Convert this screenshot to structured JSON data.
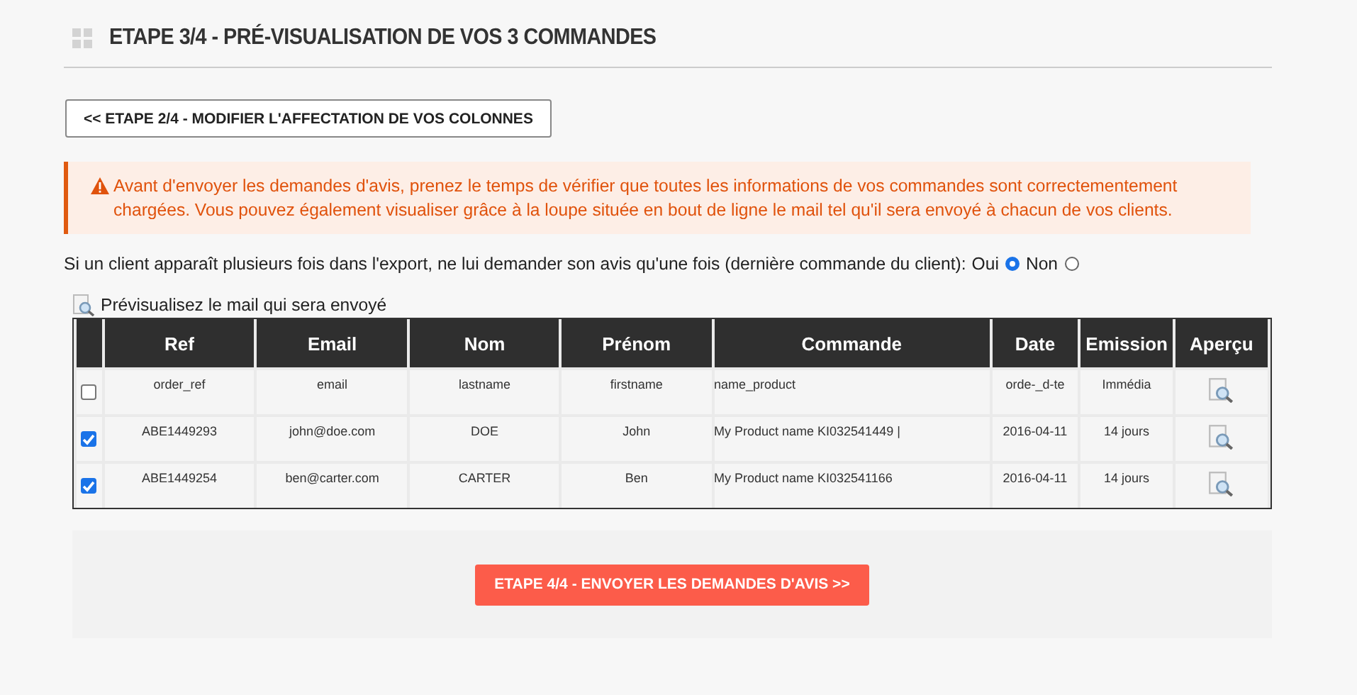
{
  "header": {
    "title": "ETAPE 3/4 - PRÉ-VISUALISATION DE VOS 3 COMMANDES"
  },
  "back_button": "<< ETAPE 2/4 - MODIFIER L'AFFECTATION DE VOS COLONNES",
  "alert": {
    "text": "Avant d'envoyer les demandes d'avis, prenez le temps de vérifier que toutes les informations de vos commandes sont correctementement chargées. Vous pouvez également visualiser grâce à la loupe située en bout de ligne le mail tel qu'il sera envoyé à chacun de vos clients."
  },
  "dedupe": {
    "question": "Si un client apparaît plusieurs fois dans l'export, ne lui demander son avis qu'une fois (dernière commande du client):",
    "options": [
      {
        "label": "Oui",
        "selected": true
      },
      {
        "label": "Non",
        "selected": false
      }
    ]
  },
  "preview_hint": "Prévisualisez le mail qui sera envoyé",
  "table": {
    "columns": [
      "Ref",
      "Email",
      "Nom",
      "Prénom",
      "Commande",
      "Date",
      "Emission",
      "Aperçu"
    ],
    "rows": [
      {
        "checked": false,
        "cells": [
          "order_ref",
          "email",
          "lastname",
          "firstname",
          "name_product",
          "orde-_d-te",
          "Immédia"
        ]
      },
      {
        "checked": true,
        "cells": [
          "ABE1449293",
          "john@doe.com",
          "DOE",
          "John",
          "My Product name KI032541449 |",
          "2016-04-11",
          "14 jours"
        ]
      },
      {
        "checked": true,
        "cells": [
          "ABE1449254",
          "ben@carter.com",
          "CARTER",
          "Ben",
          "My Product name KI032541166",
          "2016-04-11",
          "14 jours"
        ]
      }
    ]
  },
  "submit_button": "ETAPE 4/4 - ENVOYER LES DEMANDES D'AVIS >>"
}
